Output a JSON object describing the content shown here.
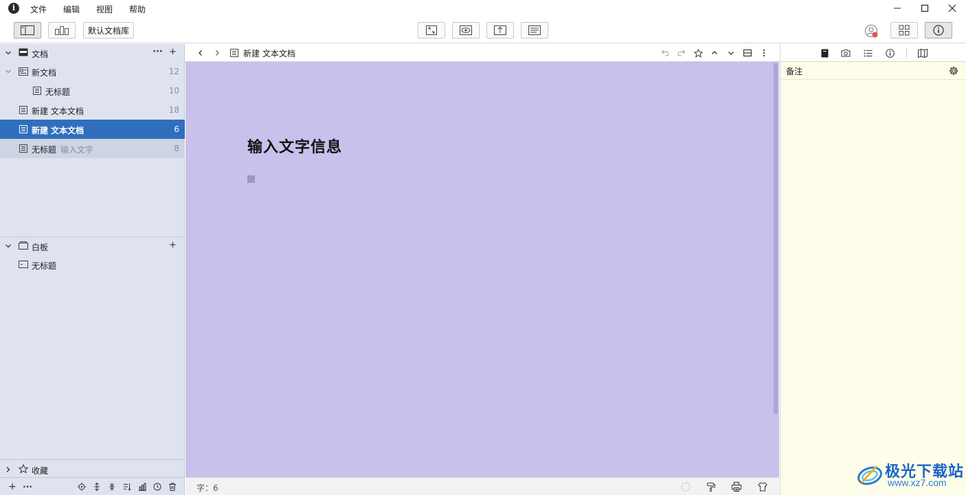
{
  "menubar": {
    "logo_letter": "i",
    "items": [
      "文件",
      "编辑",
      "视图",
      "帮助"
    ]
  },
  "toolbar": {
    "library_label": "默认文档库"
  },
  "sidebar": {
    "documents_section": {
      "title": "文档",
      "more_label": "···",
      "add_label": "+",
      "items": [
        {
          "label": "新文档",
          "count": "12",
          "level": 0,
          "type": "folder",
          "expanded": true
        },
        {
          "label": "无标题",
          "count": "10",
          "level": 1,
          "type": "doc"
        },
        {
          "label": "新建 文本文档",
          "count": "18",
          "level": 0,
          "type": "doc"
        },
        {
          "label": "新建 文本文档",
          "count": "6",
          "level": 0,
          "type": "doc",
          "selected": true
        },
        {
          "label": "无标题",
          "subtitle": "输入文字",
          "count": "8",
          "level": 0,
          "type": "doc"
        }
      ]
    },
    "whiteboard_section": {
      "title": "白板",
      "add_label": "+",
      "items": [
        {
          "label": "无标题"
        }
      ]
    },
    "favorites_section": {
      "title": "收藏"
    },
    "footer": {
      "add_label": "+",
      "more_label": "···"
    }
  },
  "editor": {
    "title": "新建 文本文档",
    "heading": "输入文字信息",
    "word_count": "字：6",
    "background": "#c7c1ec"
  },
  "inspector": {
    "notes_title": "备注",
    "background": "#fdfde9"
  },
  "watermark": {
    "text": "极光下载站",
    "url": "www.xz7.com"
  },
  "colors": {
    "sidebar_bg": "#dfe3ef",
    "selected_bg": "#2f6fbd",
    "accent": "#1a63c8"
  }
}
